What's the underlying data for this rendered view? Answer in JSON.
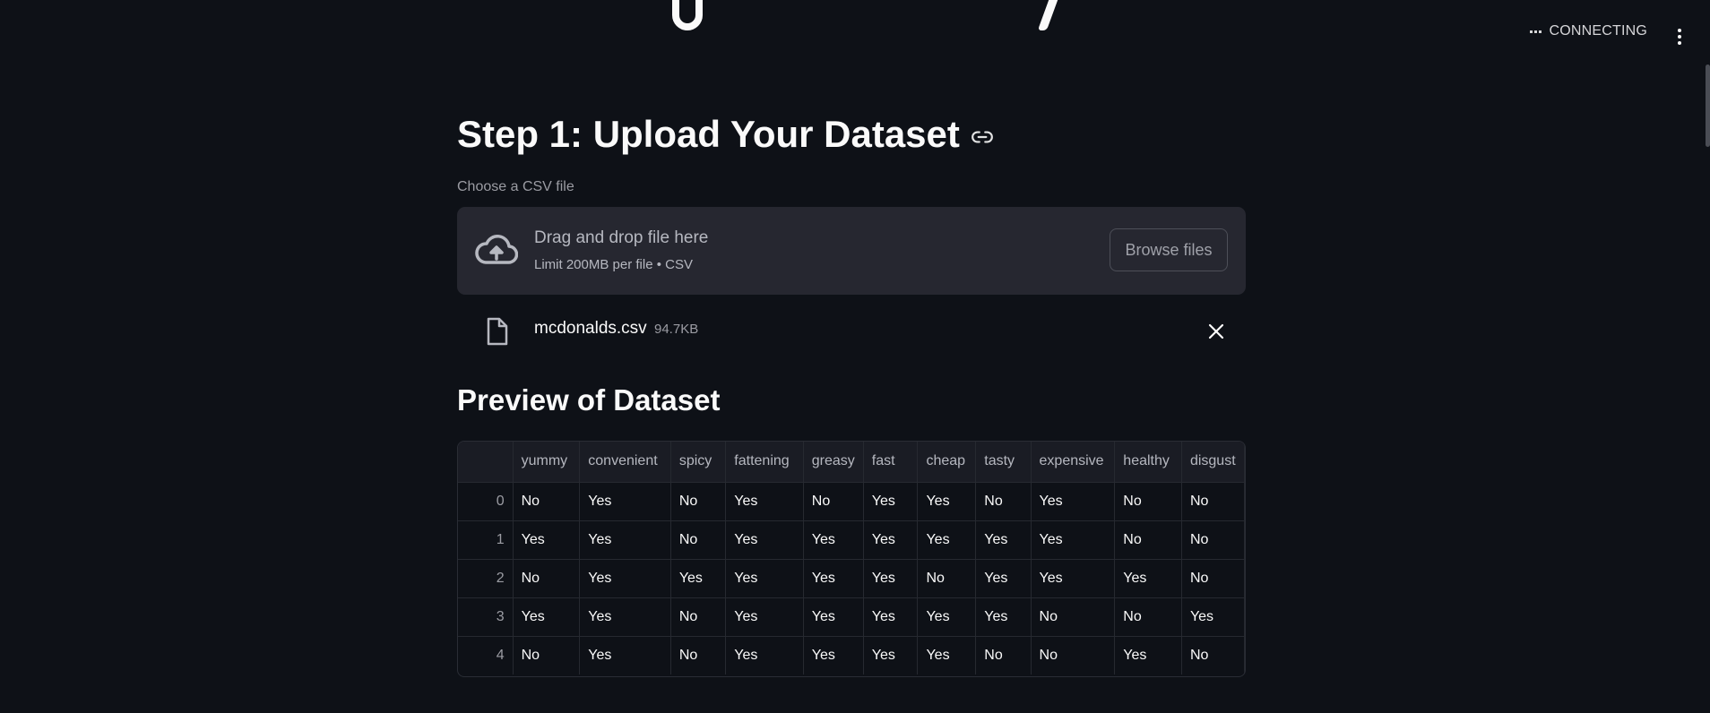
{
  "toolbar": {
    "status_label": "CONNECTING",
    "status_icon": "dots-icon",
    "menu_icon": "vertical-dots-icon"
  },
  "main": {
    "step_heading": "Step 1: Upload Your Dataset",
    "uploader": {
      "label": "Choose a CSV file",
      "drop_text": "Drag and drop file here",
      "limit_text": "Limit 200MB per file • CSV",
      "browse_label": "Browse files",
      "icon": "cloud-upload-icon"
    },
    "uploaded_file": {
      "name": "mcdonalds.csv",
      "size": "94.7KB",
      "icon": "file-icon"
    },
    "preview_heading": "Preview of Dataset",
    "table": {
      "columns": [
        "",
        "yummy",
        "convenient",
        "spicy",
        "fattening",
        "greasy",
        "fast",
        "cheap",
        "tasty",
        "expensive",
        "healthy",
        "disgust"
      ],
      "rows": [
        [
          "0",
          "No",
          "Yes",
          "No",
          "Yes",
          "No",
          "Yes",
          "Yes",
          "No",
          "Yes",
          "No",
          "No"
        ],
        [
          "1",
          "Yes",
          "Yes",
          "No",
          "Yes",
          "Yes",
          "Yes",
          "Yes",
          "Yes",
          "Yes",
          "No",
          "No"
        ],
        [
          "2",
          "No",
          "Yes",
          "Yes",
          "Yes",
          "Yes",
          "Yes",
          "No",
          "Yes",
          "Yes",
          "Yes",
          "No"
        ],
        [
          "3",
          "Yes",
          "Yes",
          "No",
          "Yes",
          "Yes",
          "Yes",
          "Yes",
          "Yes",
          "No",
          "No",
          "Yes"
        ],
        [
          "4",
          "No",
          "Yes",
          "No",
          "Yes",
          "Yes",
          "Yes",
          "Yes",
          "No",
          "No",
          "Yes",
          "No"
        ]
      ]
    }
  },
  "colors": {
    "background": "#0e1117",
    "surface": "#262730",
    "text": "#fafafa",
    "muted_text": "#9b9ca3"
  }
}
